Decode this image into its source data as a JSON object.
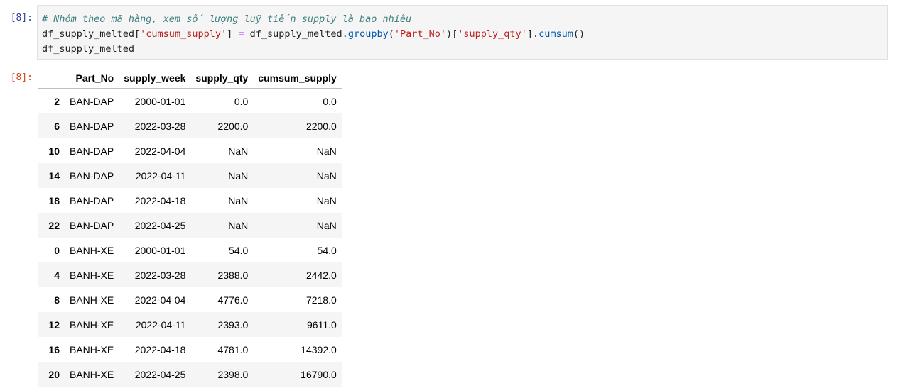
{
  "cell": {
    "in_prompt": "[8]:",
    "out_prompt": "[8]:",
    "code": {
      "comment": "# Nhóm theo mã hàng, xem số lượng luỹ tiến supply là bao nhiêu",
      "l2_a": "df_supply_melted[",
      "l2_str1": "'cumsum_supply'",
      "l2_b": "] ",
      "l2_op": "=",
      "l2_c": " df_supply_melted.",
      "l2_fn": "groupby",
      "l2_d": "(",
      "l2_str2": "'Part_No'",
      "l2_e": ")[",
      "l2_str3": "'supply_qty'",
      "l2_f": "].",
      "l2_fn2": "cumsum",
      "l2_g": "()",
      "l3": "df_supply_melted"
    }
  },
  "table": {
    "columns": [
      "",
      "Part_No",
      "supply_week",
      "supply_qty",
      "cumsum_supply"
    ],
    "rows": [
      [
        "2",
        "BAN-DAP",
        "2000-01-01",
        "0.0",
        "0.0"
      ],
      [
        "6",
        "BAN-DAP",
        "2022-03-28",
        "2200.0",
        "2200.0"
      ],
      [
        "10",
        "BAN-DAP",
        "2022-04-04",
        "NaN",
        "NaN"
      ],
      [
        "14",
        "BAN-DAP",
        "2022-04-11",
        "NaN",
        "NaN"
      ],
      [
        "18",
        "BAN-DAP",
        "2022-04-18",
        "NaN",
        "NaN"
      ],
      [
        "22",
        "BAN-DAP",
        "2022-04-25",
        "NaN",
        "NaN"
      ],
      [
        "0",
        "BANH-XE",
        "2000-01-01",
        "54.0",
        "54.0"
      ],
      [
        "4",
        "BANH-XE",
        "2022-03-28",
        "2388.0",
        "2442.0"
      ],
      [
        "8",
        "BANH-XE",
        "2022-04-04",
        "4776.0",
        "7218.0"
      ],
      [
        "12",
        "BANH-XE",
        "2022-04-11",
        "2393.0",
        "9611.0"
      ],
      [
        "16",
        "BANH-XE",
        "2022-04-18",
        "4781.0",
        "14392.0"
      ],
      [
        "20",
        "BANH-XE",
        "2022-04-25",
        "2398.0",
        "16790.0"
      ]
    ]
  }
}
